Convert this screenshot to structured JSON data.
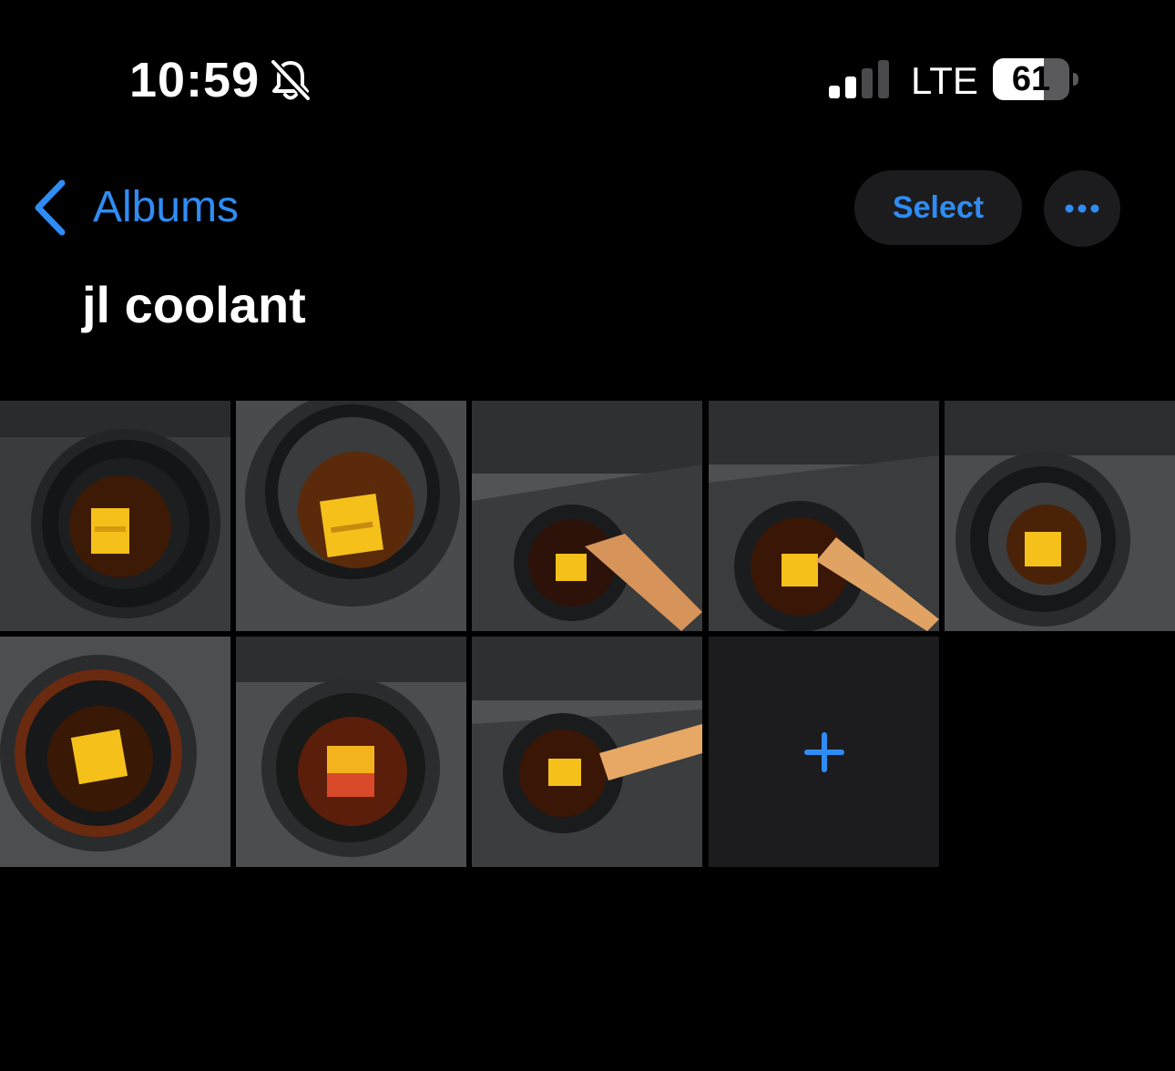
{
  "status_bar": {
    "time": "10:59",
    "network": "LTE",
    "battery": "61",
    "icons": [
      "bell-slash-icon",
      "signal-bars-icon",
      "battery-icon"
    ]
  },
  "nav": {
    "back_label": "Albums",
    "select_label": "Select",
    "more_icon": "ellipsis-icon"
  },
  "album": {
    "title": "jl coolant"
  },
  "photos": [
    {
      "name": "photo-1"
    },
    {
      "name": "photo-2"
    },
    {
      "name": "photo-3"
    },
    {
      "name": "photo-4"
    },
    {
      "name": "photo-5"
    },
    {
      "name": "photo-6"
    },
    {
      "name": "photo-7"
    },
    {
      "name": "photo-8"
    }
  ],
  "add_tile": {
    "icon": "plus-icon"
  },
  "colors": {
    "accent": "#2f8cf5",
    "background": "#000000",
    "button_bg": "#1c1c1e"
  }
}
